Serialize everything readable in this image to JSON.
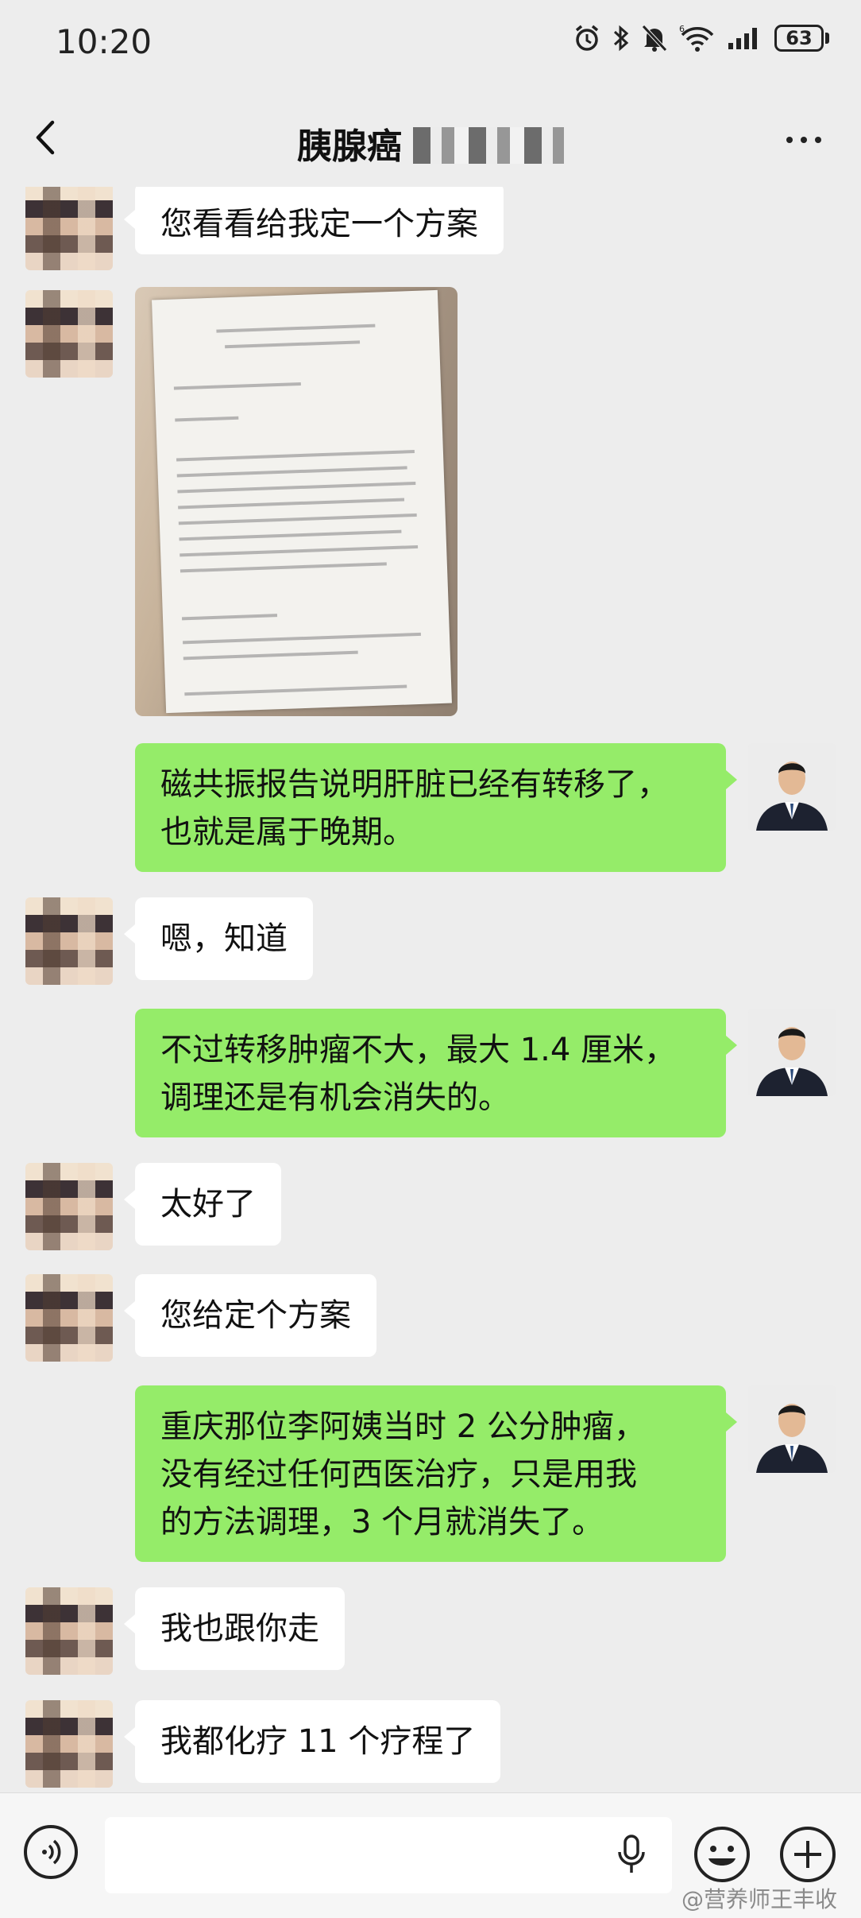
{
  "status_bar": {
    "time": "10:20",
    "battery": "63",
    "icons": [
      "alarm-icon",
      "bluetooth-icon",
      "mute-icon",
      "wifi-6-icon",
      "signal-icon",
      "battery-icon"
    ]
  },
  "nav": {
    "title": "胰腺癌",
    "back_icon": "chevron-left-icon",
    "more_icon": "more-dots-icon"
  },
  "messages": [
    {
      "from": "patient",
      "text": "您看看给我定一个方案"
    },
    {
      "from": "patient",
      "type": "image",
      "icon": "photo-of-medical-report"
    },
    {
      "from": "doctor",
      "lines": [
        "磁共振报告说明肝脏已经有转移了，",
        "也就是属于晚期。"
      ]
    },
    {
      "from": "patient",
      "text": "嗯，知道"
    },
    {
      "from": "doctor",
      "lines": [
        "不过转移肿瘤不大，最大 1.4 厘米，",
        "调理还是有机会消失的。"
      ]
    },
    {
      "from": "patient",
      "text": "太好了"
    },
    {
      "from": "patient",
      "text": "您给定个方案"
    },
    {
      "from": "doctor",
      "lines": [
        "重庆那位李阿姨当时 2 公分肿瘤，",
        "没有经过任何西医治疗，只是用我",
        "的方法调理，3 个月就消失了。"
      ]
    },
    {
      "from": "patient",
      "text": "我也跟你走"
    },
    {
      "from": "patient",
      "text": "我都化疗 11 个疗程了"
    }
  ],
  "input_bar": {
    "voice_icon": "voice-input-icon",
    "mic_icon": "microphone-icon",
    "emoji_icon": "emoji-icon",
    "plus_icon": "plus-icon",
    "text": ""
  },
  "watermark": "@营养师王丰收",
  "colors": {
    "background": "#ededed",
    "incoming_bubble": "#ffffff",
    "outgoing_bubble": "#95ec69"
  }
}
